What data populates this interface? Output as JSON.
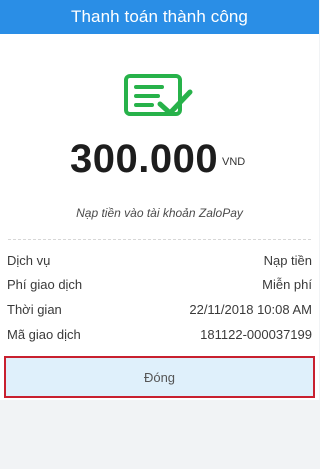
{
  "header": {
    "title": "Thanh toán thành công"
  },
  "success": {
    "icon": "receipt-check-icon",
    "icon_color": "#27b24a"
  },
  "payment": {
    "amount": "300.000",
    "currency": "VND",
    "description": "Nạp tiền vào tài khoản ZaloPay"
  },
  "details": [
    {
      "label": "Dịch vụ",
      "value": "Nạp tiền"
    },
    {
      "label": "Phí giao dịch",
      "value": "Miễn phí"
    },
    {
      "label": "Thời gian",
      "value": "22/11/2018 10:08 AM"
    },
    {
      "label": "Mã giao dịch",
      "value": "181122-000037199"
    }
  ],
  "actions": {
    "close_label": "Đóng"
  },
  "colors": {
    "header": "#2a8ee6",
    "success_green": "#27b24a",
    "close_button_bg": "#dff0fb",
    "highlight_border": "#c8202f"
  }
}
